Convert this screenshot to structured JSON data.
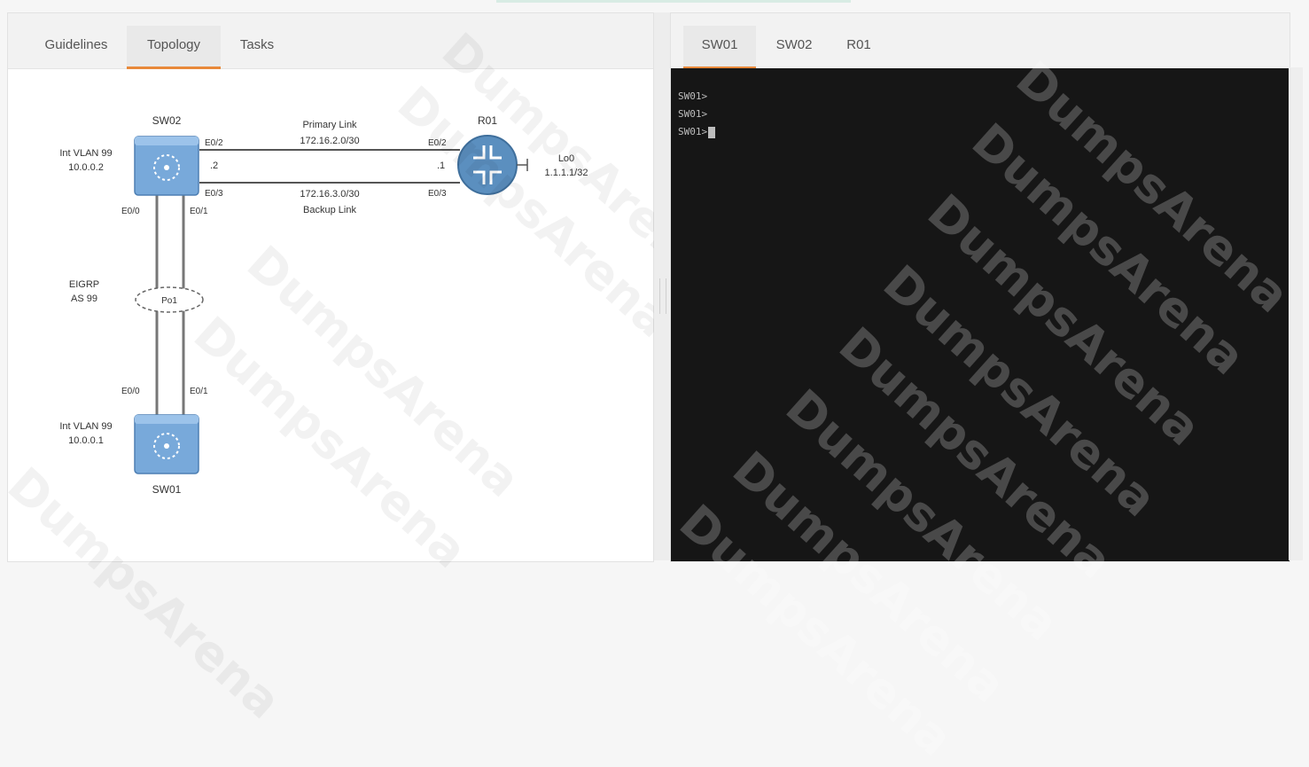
{
  "left_panel": {
    "tabs": [
      {
        "label": "Guidelines"
      },
      {
        "label": "Topology"
      },
      {
        "label": "Tasks"
      }
    ],
    "active_tab": "Topology"
  },
  "topology": {
    "sw02": {
      "name": "SW02",
      "vlan": "Int VLAN 99",
      "ip": "10.0.0.2",
      "ports": {
        "e02": "E0/2",
        "e03": "E0/3",
        "e00": "E0/0",
        "e01": "E0/1"
      },
      "host_octet": ".2"
    },
    "sw01": {
      "name": "SW01",
      "vlan": "Int VLAN 99",
      "ip": "10.0.0.1",
      "ports": {
        "e00": "E0/0",
        "e01": "E0/1"
      }
    },
    "r01": {
      "name": "R01",
      "ports": {
        "e02": "E0/2",
        "e03": "E0/3"
      },
      "host_octet": ".1",
      "loopback": {
        "name": "Lo0",
        "ip": "1.1.1.1/32"
      }
    },
    "primary_link": {
      "label": "Primary Link",
      "subnet": "172.16.2.0/30"
    },
    "backup_link": {
      "label": "Backup Link",
      "subnet": "172.16.3.0/30"
    },
    "etherchannel": {
      "label": "Po1",
      "protocol": "EIGRP",
      "as": "AS 99"
    }
  },
  "right_panel": {
    "tabs": [
      {
        "label": "SW01"
      },
      {
        "label": "SW02"
      },
      {
        "label": "R01"
      }
    ],
    "active_tab": "SW01",
    "terminal_lines": [
      "SW01>",
      "SW01>",
      "SW01>"
    ]
  },
  "watermark_text": "DumpsArena",
  "colors": {
    "active_tab_underline": "#e8893a",
    "device_blue": "#6f9fd0",
    "router_blue": "#5b8fbf",
    "terminal_bg": "#161616"
  }
}
